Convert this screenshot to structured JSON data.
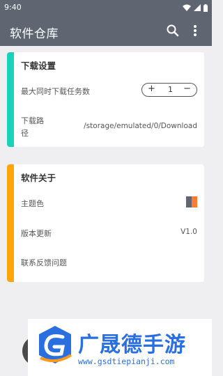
{
  "status_bar": {
    "time": "9:40"
  },
  "app_bar": {
    "title": "软件仓库"
  },
  "download_card": {
    "header": "下载设置",
    "accent_color": "#19d2b8",
    "max_tasks_label": "最大同时下载任务数",
    "stepper": {
      "plus": "+",
      "value": "1",
      "minus": "−"
    },
    "path_label_line1": "下载路",
    "path_label_line2": "径",
    "path_value": "/storage/emulated/0/Download"
  },
  "about_card": {
    "header": "软件关于",
    "accent_color": "#ffa50a",
    "theme_label": "主题色",
    "theme_colors": [
      "#5f6672",
      "#ff7a33"
    ],
    "version_label": "版本更新",
    "version_value": "V1.0",
    "feedback_label": "联系反馈问题"
  },
  "watermark": {
    "brand": "广晟德手游",
    "url": "www.gsdtiepianji.com"
  }
}
